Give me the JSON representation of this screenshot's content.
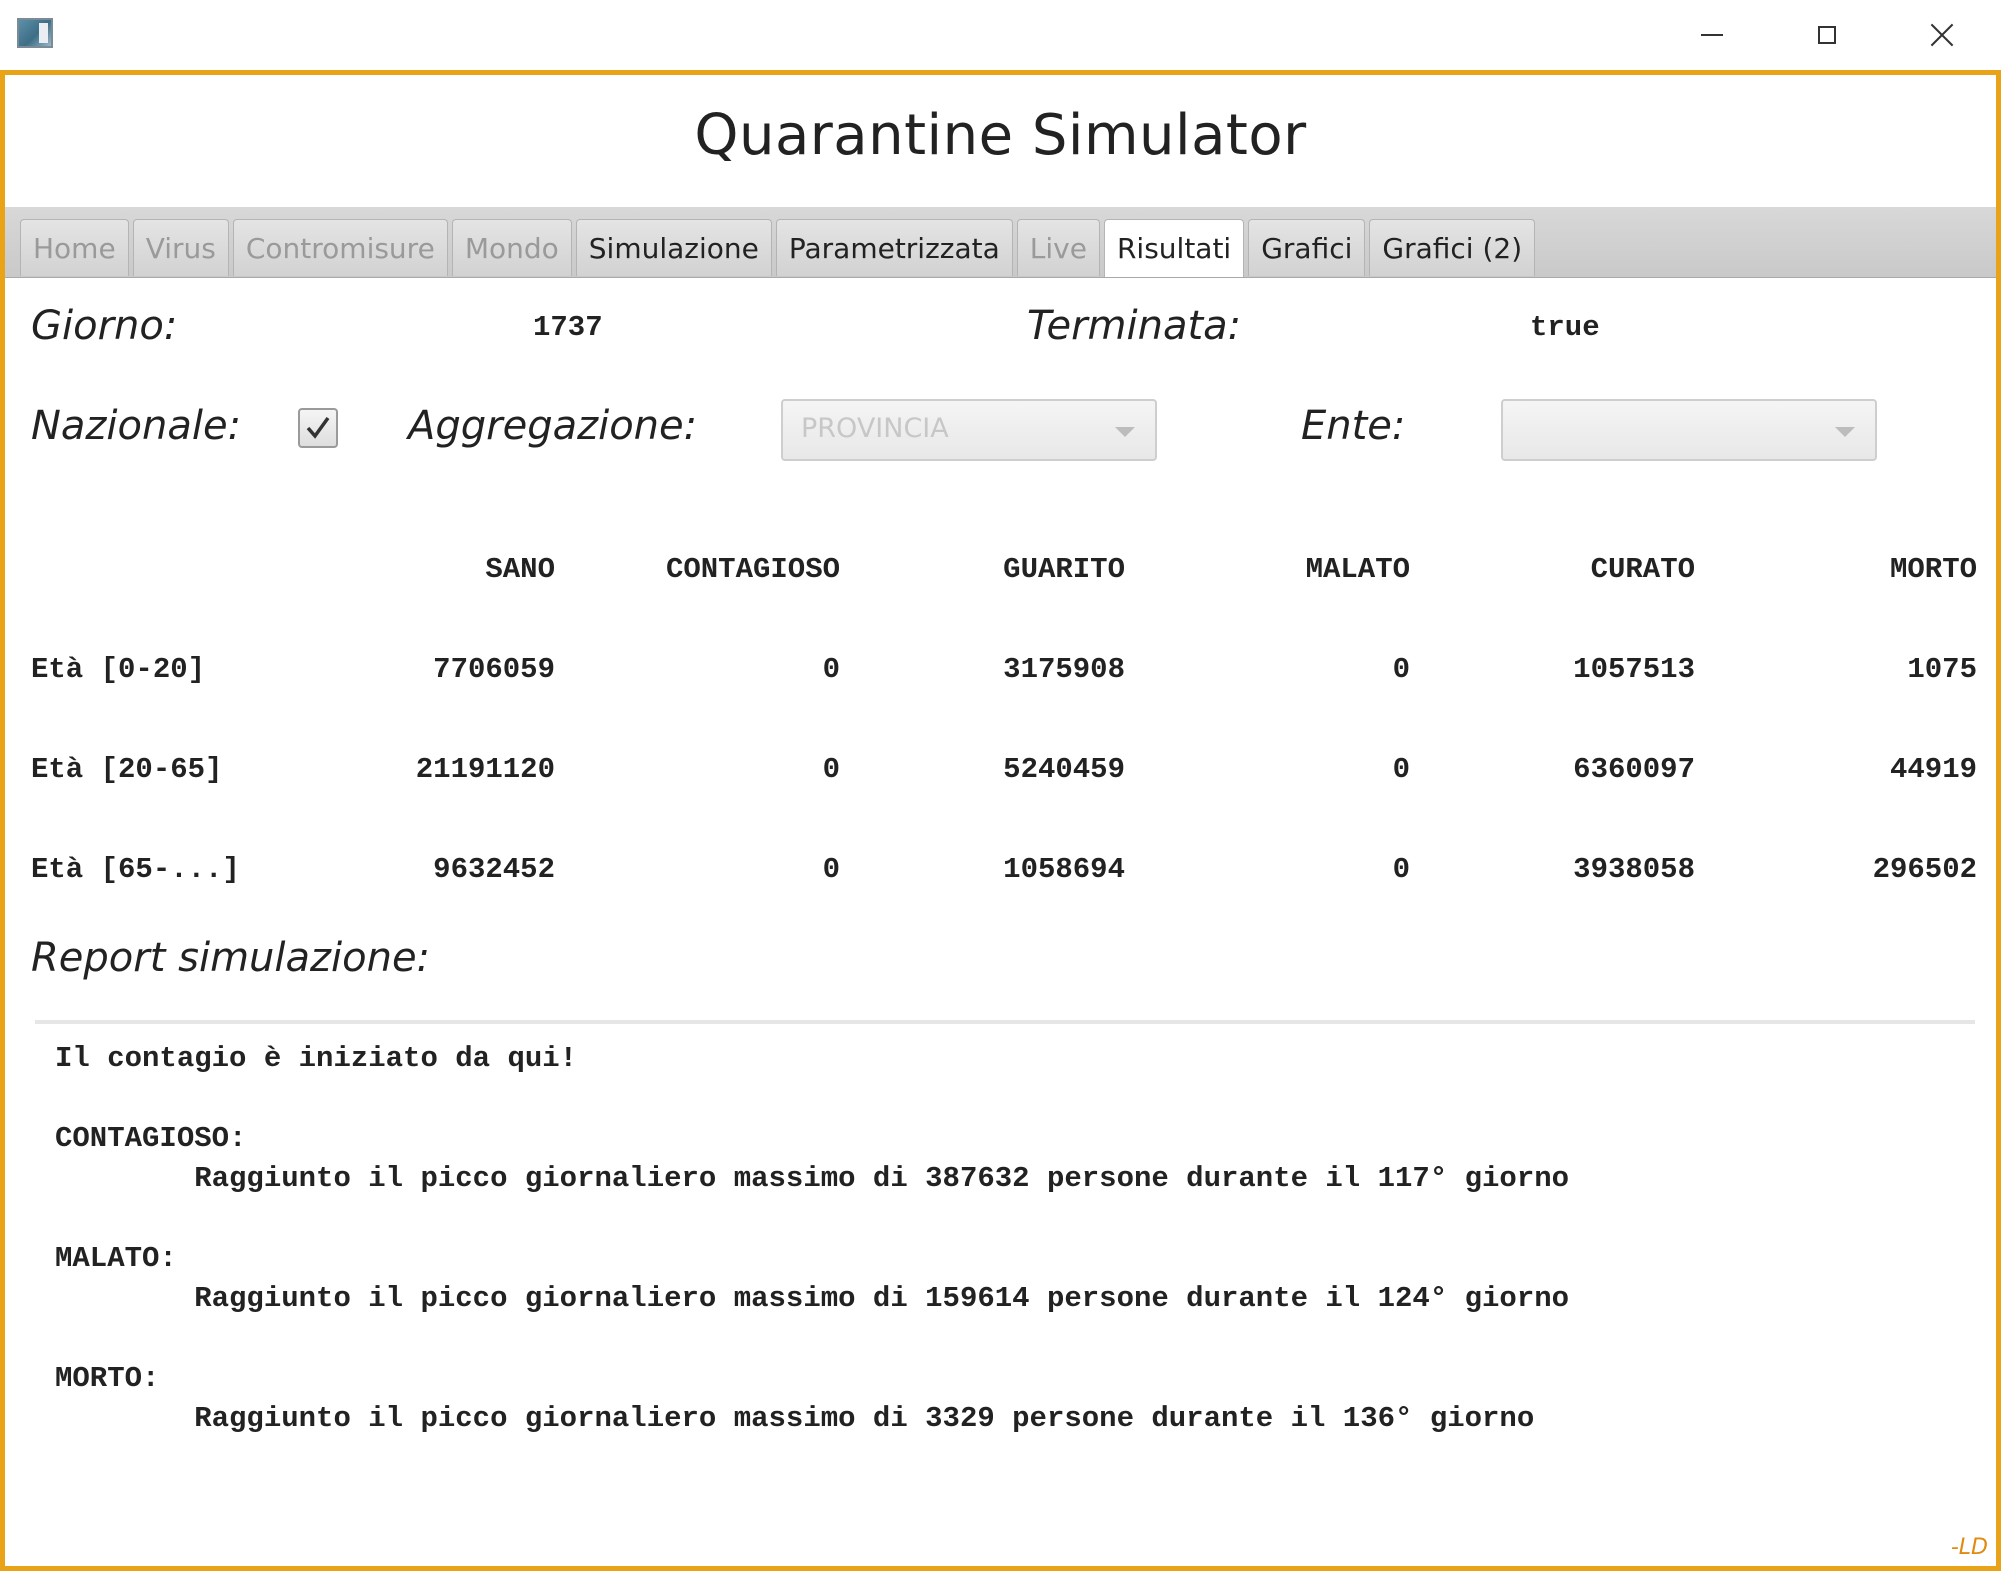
{
  "window": {
    "title": ""
  },
  "app": {
    "title": "Quarantine Simulator"
  },
  "tabs": [
    {
      "label": "Home",
      "state": "disabled"
    },
    {
      "label": "Virus",
      "state": "disabled"
    },
    {
      "label": "Contromisure",
      "state": "disabled"
    },
    {
      "label": "Mondo",
      "state": "disabled"
    },
    {
      "label": "Simulazione",
      "state": "enabled"
    },
    {
      "label": "Parametrizzata",
      "state": "enabled"
    },
    {
      "label": "Live",
      "state": "disabled"
    },
    {
      "label": "Risultati",
      "state": "selected"
    },
    {
      "label": "Grafici",
      "state": "enabled"
    },
    {
      "label": "Grafici (2)",
      "state": "enabled"
    }
  ],
  "status": {
    "giorno_label": "Giorno:",
    "giorno_value": "1737",
    "terminata_label": "Terminata:",
    "terminata_value": "true"
  },
  "filters": {
    "nazionale_label": "Nazionale:",
    "nazionale_checked": true,
    "aggregazione_label": "Aggregazione:",
    "aggregazione_value": "PROVINCIA",
    "ente_label": "Ente:",
    "ente_value": ""
  },
  "table": {
    "columns": [
      "SANO",
      "CONTAGIOSO",
      "GUARITO",
      "MALATO",
      "CURATO",
      "MORTO"
    ],
    "rows": [
      {
        "label": "Età [0-20]",
        "values": [
          "7706059",
          "0",
          "3175908",
          "0",
          "1057513",
          "1075"
        ]
      },
      {
        "label": "Età [20-65]",
        "values": [
          "21191120",
          "0",
          "5240459",
          "0",
          "6360097",
          "44919"
        ]
      },
      {
        "label": "Età [65-...]",
        "values": [
          "9632452",
          "0",
          "1058694",
          "0",
          "3938058",
          "296502"
        ]
      }
    ]
  },
  "report": {
    "label": "Report simulazione:",
    "lines": [
      "Il contagio è iniziato da qui!",
      "",
      "CONTAGIOSO:",
      "        Raggiunto il picco giornaliero massimo di 387632 persone durante il 117° giorno",
      "",
      "MALATO:",
      "        Raggiunto il picco giornaliero massimo di 159614 persone durante il 124° giorno",
      "",
      "MORTO:",
      "        Raggiunto il picco giornaliero massimo di 3329 persone durante il 136° giorno"
    ]
  },
  "signature": "-LD",
  "colors": {
    "frame_border": "#e8a318",
    "signature": "#e08a10"
  },
  "icons": {
    "app": "app-window-icon",
    "minimize": "minimize-icon",
    "maximize": "maximize-icon",
    "close": "close-icon",
    "check": "checkmark-icon",
    "dropdown": "chevron-down-icon"
  }
}
